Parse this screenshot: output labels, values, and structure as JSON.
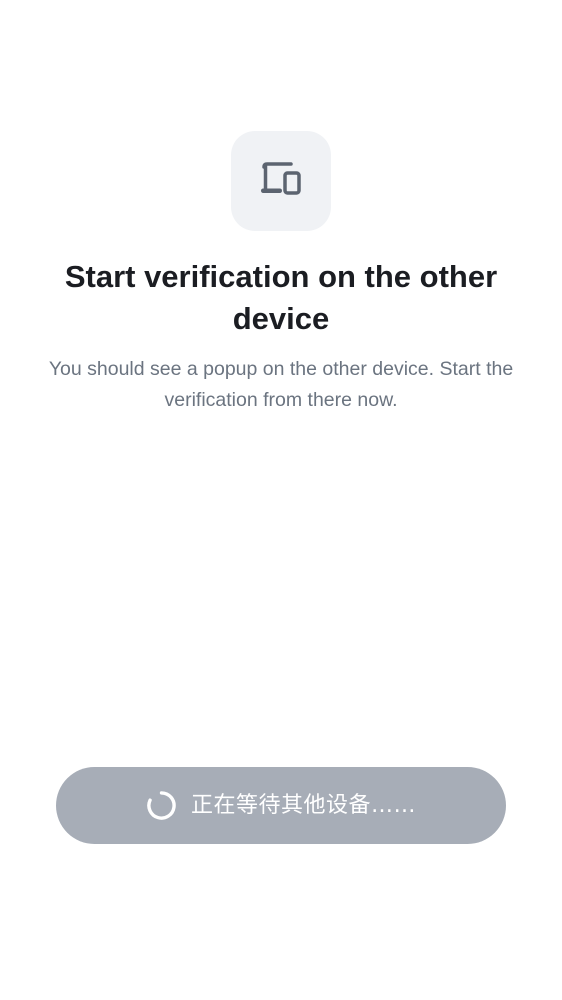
{
  "header": {
    "icon": "devices-icon",
    "title": "Start verification on the other device",
    "subtitle": "You should see a popup on the other device. Start the verification from there now."
  },
  "wait_button": {
    "label": "正在等待其他设备……",
    "icon": "spinner-icon",
    "state": "disabled"
  },
  "colors": {
    "background": "#ffffff",
    "icon_tile": "#f0f2f5",
    "icon": "#5c6470",
    "title": "#1b1d22",
    "subtitle": "#6b7480",
    "button_disabled": "#a7adb7",
    "button_text": "#ffffff"
  }
}
